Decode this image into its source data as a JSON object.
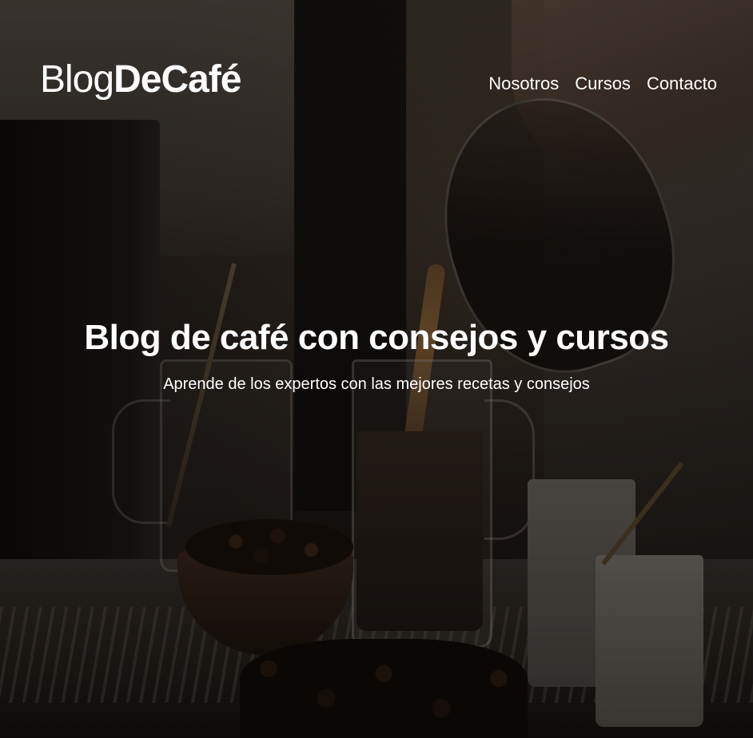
{
  "header": {
    "logo_light": "Blog",
    "logo_bold": "DeCafé"
  },
  "nav": {
    "items": [
      {
        "label": "Nosotros"
      },
      {
        "label": "Cursos"
      },
      {
        "label": "Contacto"
      }
    ]
  },
  "hero": {
    "title": "Blog de café con consejos y cursos",
    "subtitle": "Aprende de los expertos con las mejores recetas y consejos"
  },
  "colors": {
    "text": "#ffffff",
    "overlay": "#000000"
  }
}
